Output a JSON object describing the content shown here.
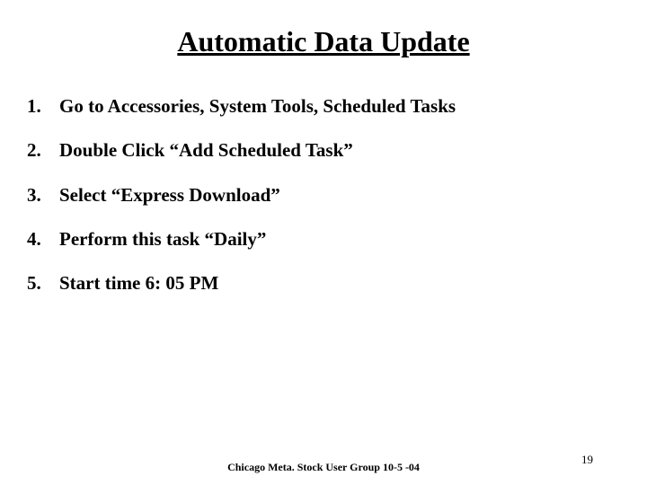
{
  "title": "Automatic Data Update",
  "steps": [
    {
      "n": "1.",
      "text": "Go to Accessories, System Tools, Scheduled Tasks"
    },
    {
      "n": "2.",
      "text": "Double Click “Add Scheduled Task”"
    },
    {
      "n": "3.",
      "text": "Select “Express Download”"
    },
    {
      "n": "4.",
      "text": "Perform this task “Daily”"
    },
    {
      "n": "5.",
      "text": "Start time 6: 05 PM"
    }
  ],
  "footer": {
    "center": "Chicago Meta. Stock User Group 10-5 -04",
    "page": "19"
  }
}
